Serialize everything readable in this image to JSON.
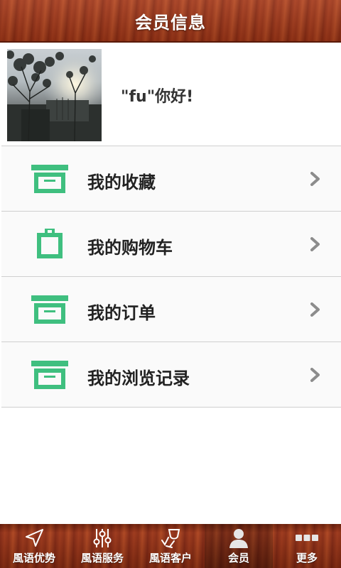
{
  "header": {
    "title": "会员信息"
  },
  "profile": {
    "greeting": "\"fu\"你好!"
  },
  "menu": {
    "items": [
      {
        "label": "我的收藏",
        "icon": "archive-box-icon"
      },
      {
        "label": "我的购物车",
        "icon": "clipboard-icon"
      },
      {
        "label": "我的订单",
        "icon": "archive-box-icon"
      },
      {
        "label": "我的浏览记录",
        "icon": "archive-box-icon"
      }
    ]
  },
  "tabbar": {
    "tabs": [
      {
        "label": "風语优势",
        "icon": "navigation-arrow-icon",
        "active": false
      },
      {
        "label": "風语服务",
        "icon": "sliders-icon",
        "active": false
      },
      {
        "label": "風语客户",
        "icon": "wine-glass-icon",
        "active": false
      },
      {
        "label": "会员",
        "icon": "user-icon",
        "active": true
      },
      {
        "label": "更多",
        "icon": "more-dots-icon",
        "active": false
      }
    ]
  },
  "colors": {
    "accent_green": "#3fbf7f",
    "header_wood": "#9b3316",
    "chevron_gray": "#8c8c8c"
  }
}
